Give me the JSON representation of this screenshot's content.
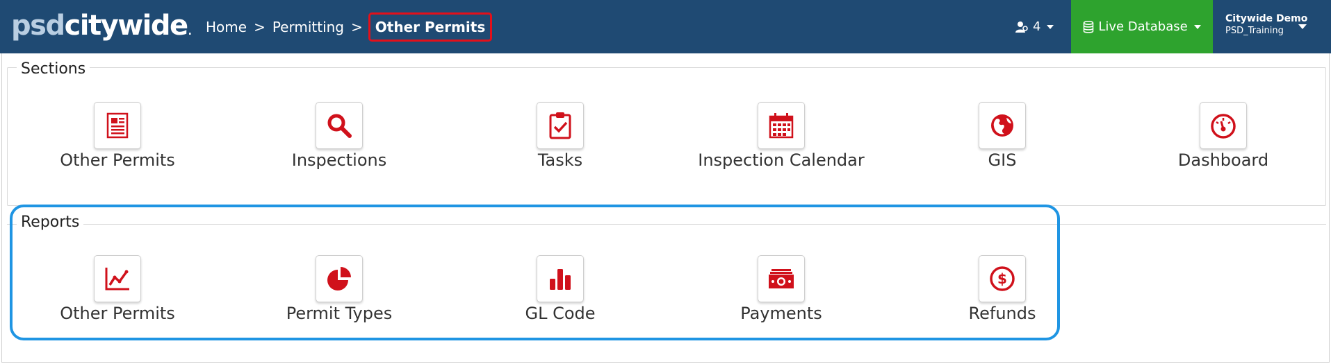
{
  "brand": {
    "part1": "psd",
    "part2": "citywide",
    "mark": "."
  },
  "breadcrumb": {
    "home": "Home",
    "sep1": ">",
    "permitting": "Permitting",
    "sep2": ">",
    "current": "Other Permits"
  },
  "header": {
    "users_count": "4",
    "database_label": "Live Database",
    "account_name": "Citywide Demo",
    "account_db": "PSD_Training"
  },
  "colors": {
    "navbar": "#1f4a73",
    "live_db": "#2ea32e",
    "icon_red": "#d0111b",
    "highlight_blue": "#1f95e3",
    "breadcrumb_highlight": "#e3101a"
  },
  "sections": {
    "title": "Sections",
    "items": [
      {
        "label": "Other Permits",
        "icon": "document-list-icon"
      },
      {
        "label": "Inspections",
        "icon": "search-icon"
      },
      {
        "label": "Tasks",
        "icon": "clipboard-check-icon"
      },
      {
        "label": "Inspection Calendar",
        "icon": "calendar-icon"
      },
      {
        "label": "GIS",
        "icon": "globe-icon"
      },
      {
        "label": "Dashboard",
        "icon": "gauge-icon"
      }
    ]
  },
  "reports": {
    "title": "Reports",
    "items": [
      {
        "label": "Other Permits",
        "icon": "line-chart-icon"
      },
      {
        "label": "Permit Types",
        "icon": "pie-chart-icon"
      },
      {
        "label": "GL Code",
        "icon": "bar-chart-icon"
      },
      {
        "label": "Payments",
        "icon": "money-icon"
      },
      {
        "label": "Refunds",
        "icon": "dollar-circle-icon"
      }
    ]
  }
}
